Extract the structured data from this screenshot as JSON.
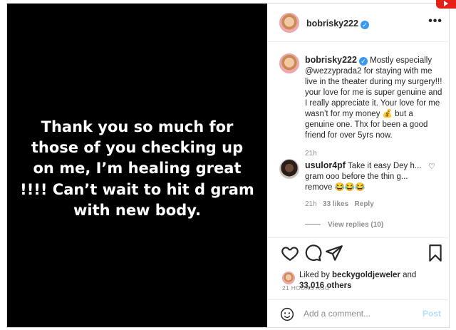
{
  "post": {
    "image_text": "Thank you so much for those of you checking up on me, I’m healing great !!!! Can’t wait to hit d gram with new body.",
    "author": "bobrisky222",
    "more_icon": "•••",
    "verified_icon": "✓"
  },
  "caption": {
    "author": "bobrisky222",
    "text": " Mostly especially @wezzyprada2 for staying with me live in the theater during my surgery!!! your love for me is super genuine and I really appreciate it. Your love for me wasn’t for my money 💰 but a genuine one. Thx for been a good friend for over 5yrs now.",
    "time": "21h"
  },
  "comment": {
    "author": "usulor4pf",
    "text": " Take it easy Dey h... gram ooo before the thin g... remove 😂😂😂",
    "time": "21h",
    "likes": "33 likes",
    "reply_label": "Reply",
    "view_replies": "View replies (10)",
    "heart_icon": "♡"
  },
  "likes": {
    "liked_by_prefix": "Liked by ",
    "liked_by_user": "beckygoldjeweler",
    "liked_by_and": " and",
    "others": "33,016 others"
  },
  "timestamp": "21 HOURS AGO",
  "add_comment": {
    "placeholder": "Add a comment...",
    "post_label": "Post"
  },
  "colors": {
    "verified": "#3897f0",
    "post_button": "#b2dffc",
    "photo_bg": "#000000"
  }
}
